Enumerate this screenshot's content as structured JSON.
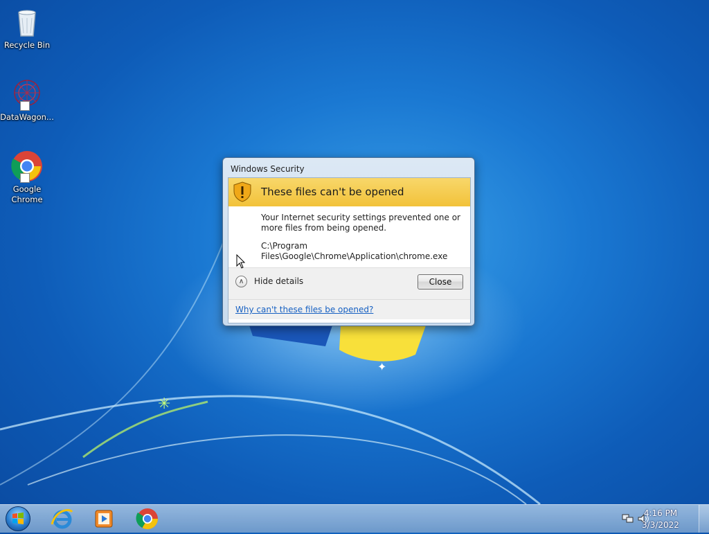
{
  "desktop": {
    "icons": [
      {
        "label": "Recycle Bin"
      },
      {
        "label": "DataWagon..."
      },
      {
        "label": "Google\nChrome"
      }
    ]
  },
  "dialog": {
    "title": "Windows Security",
    "heading": "These files can't be opened",
    "message": "Your Internet security settings prevented one or more files from being opened.",
    "path": "C:\\Program Files\\Google\\Chrome\\Application\\chrome.exe",
    "hide_details_label": "Hide details",
    "close_label": "Close",
    "help_link": "Why can't these files be opened?"
  },
  "taskbar": {
    "clock_time": "4:16 PM",
    "clock_date": "3/3/2022"
  },
  "colors": {
    "banner": "#f2c23a",
    "link": "#1660c2"
  }
}
